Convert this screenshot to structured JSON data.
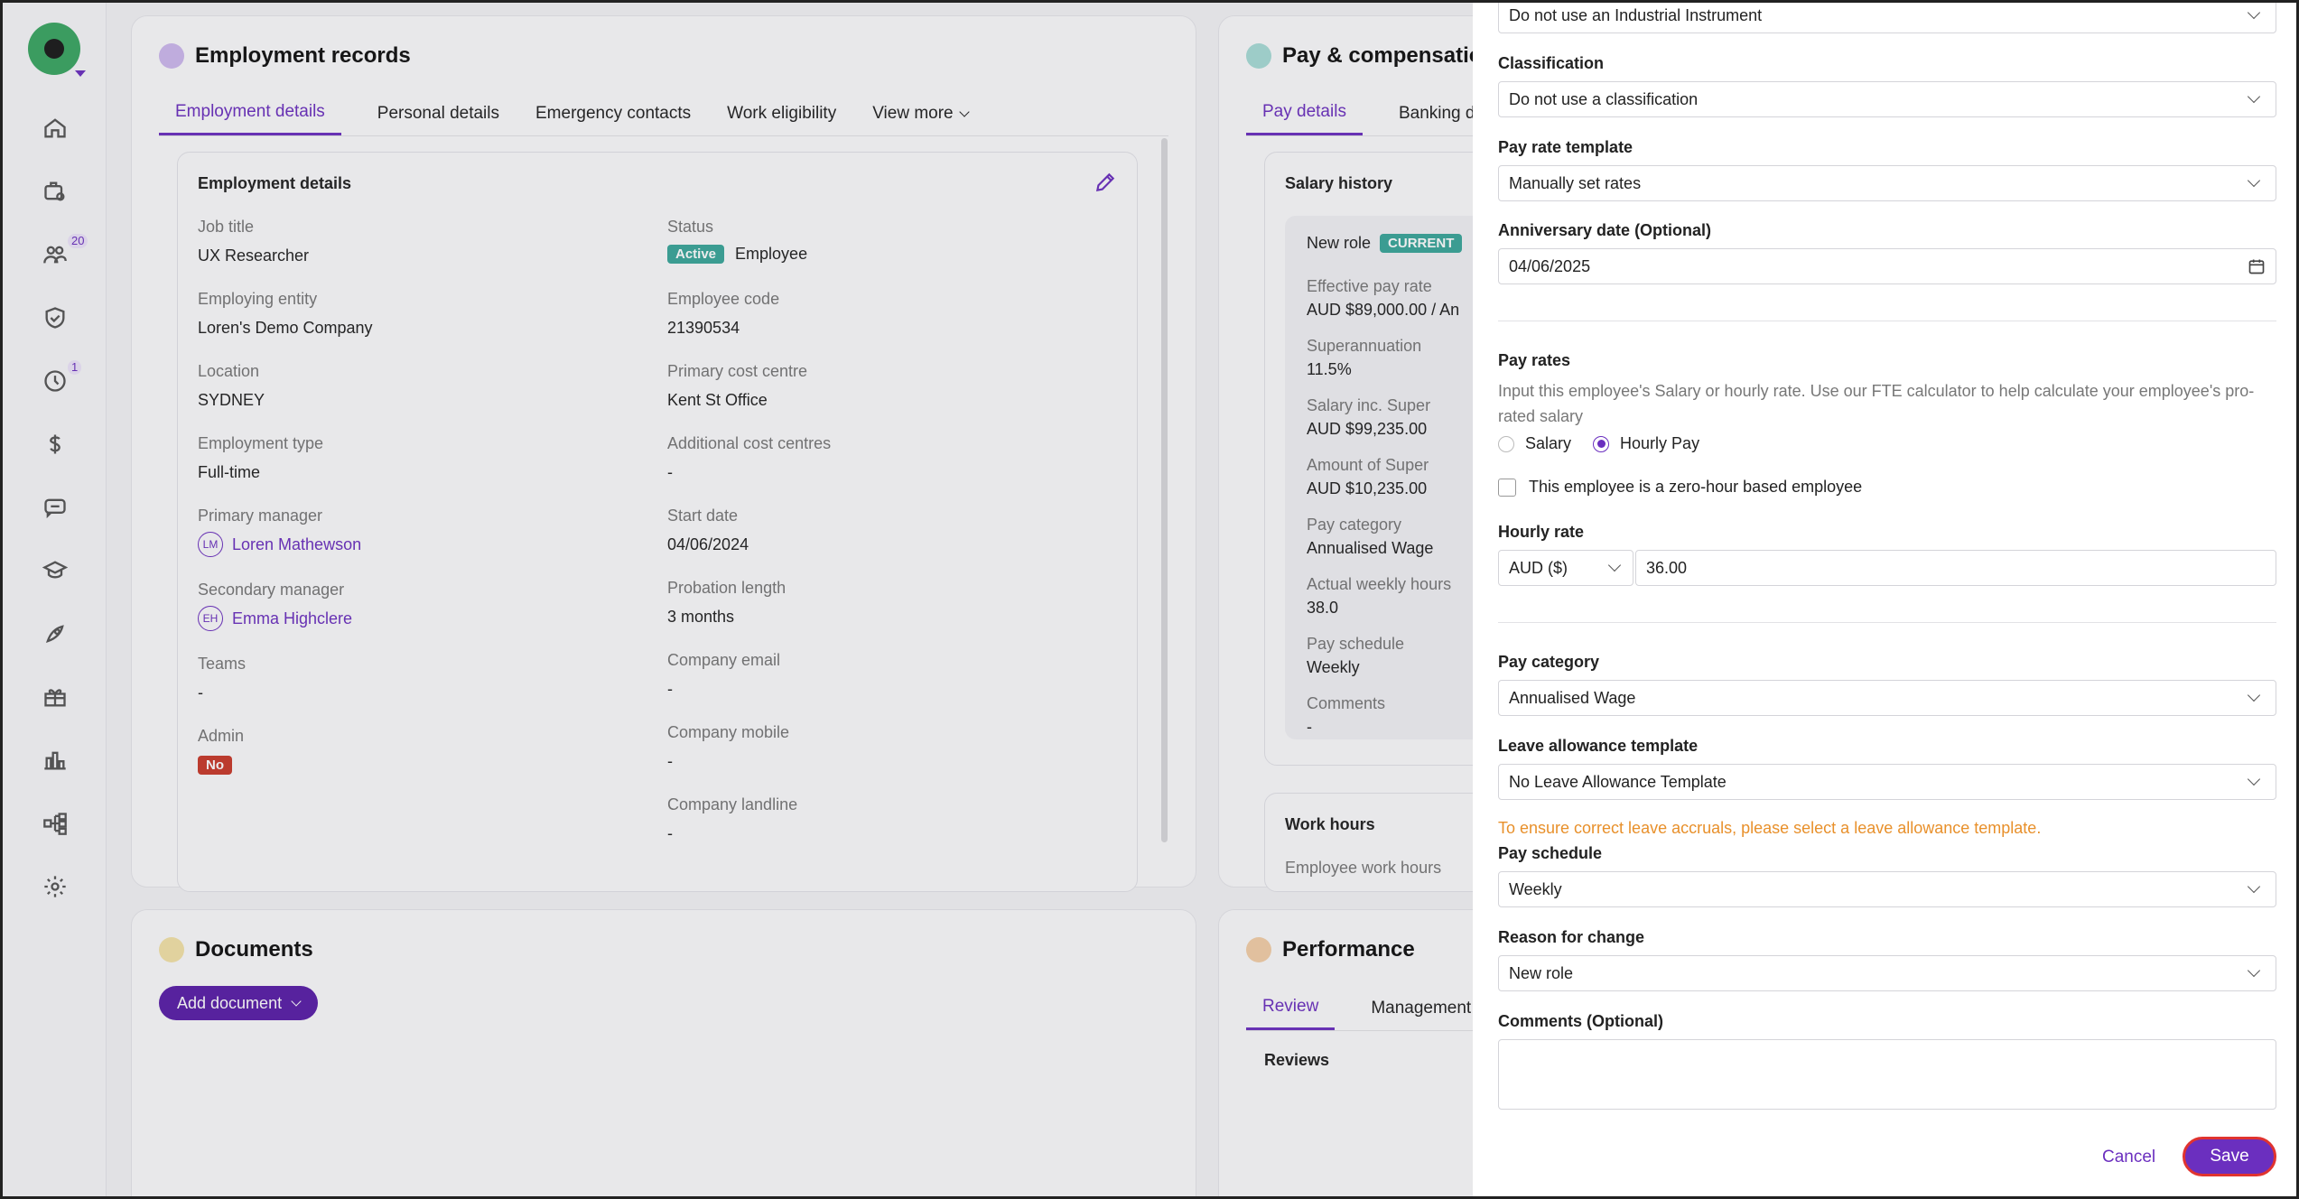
{
  "sidebar": {
    "badges": {
      "people": "20",
      "time": "1"
    }
  },
  "employment": {
    "title": "Employment records",
    "tabs": [
      "Employment details",
      "Personal details",
      "Emergency contacts",
      "Work eligibility",
      "View more"
    ],
    "section_title": "Employment details",
    "left_fields": [
      {
        "label": "Job title",
        "value": "UX Researcher"
      },
      {
        "label": "Employing entity",
        "value": "Loren's Demo Company"
      },
      {
        "label": "Location",
        "value": "SYDNEY"
      },
      {
        "label": "Employment type",
        "value": "Full-time"
      },
      {
        "label": "Primary manager",
        "value": "Loren Mathewson",
        "initials": "LM"
      },
      {
        "label": "Secondary manager",
        "value": "Emma Highclere",
        "initials": "EH"
      },
      {
        "label": "Teams",
        "value": "-"
      },
      {
        "label": "Admin",
        "value": "No"
      }
    ],
    "right_fields": [
      {
        "label": "Status",
        "badge": "Active",
        "value": "Employee"
      },
      {
        "label": "Employee code",
        "value": "21390534"
      },
      {
        "label": "Primary cost centre",
        "value": "Kent St Office"
      },
      {
        "label": "Additional cost centres",
        "value": "-"
      },
      {
        "label": "Start date",
        "value": "04/06/2024"
      },
      {
        "label": "Probation length",
        "value": "3 months"
      },
      {
        "label": "Company email",
        "value": "-"
      },
      {
        "label": "Company mobile",
        "value": "-"
      },
      {
        "label": "Company landline",
        "value": "-"
      }
    ]
  },
  "pay": {
    "title": "Pay & compensatio",
    "tabs": [
      "Pay details",
      "Banking det"
    ],
    "salary_history_title": "Salary history",
    "role_label": "New role",
    "current_badge": "CURRENT",
    "fields": [
      {
        "label": "Effective pay rate",
        "value": "AUD $89,000.00 / An"
      },
      {
        "label": "Superannuation",
        "value": "11.5%"
      },
      {
        "label": "Salary inc. Super",
        "value": "AUD $99,235.00"
      },
      {
        "label": "Amount of Super",
        "value": "AUD $10,235.00"
      },
      {
        "label": "Pay category",
        "value": "Annualised Wage"
      },
      {
        "label": "Actual weekly hours",
        "value": "38.0"
      },
      {
        "label": "Pay schedule",
        "value": "Weekly"
      },
      {
        "label": "Comments",
        "value": "-"
      }
    ],
    "work_hours_title": "Work hours",
    "work_hours_sub": "Employee work hours"
  },
  "documents": {
    "title": "Documents",
    "add_button": "Add document"
  },
  "performance": {
    "title": "Performance",
    "tabs": [
      "Review",
      "Management n"
    ],
    "reviews_label": "Reviews"
  },
  "drawer": {
    "industrial_instrument": "Do not use an Industrial Instrument",
    "classification_label": "Classification",
    "classification_value": "Do not use a classification",
    "pay_rate_template_label": "Pay rate template",
    "pay_rate_template_value": "Manually set rates",
    "anniversary_label": "Anniversary date (Optional)",
    "anniversary_value": "04/06/2025",
    "pay_rates_label": "Pay rates",
    "pay_rates_help": "Input this employee's Salary or hourly rate. Use our FTE calculator to help calculate your employee's pro-rated salary",
    "radio_salary": "Salary",
    "radio_hourly": "Hourly Pay",
    "zero_hour_label": "This employee is a zero-hour based employee",
    "hourly_rate_label": "Hourly rate",
    "currency_value": "AUD ($)",
    "hourly_rate_value": "36.00",
    "pay_category_label": "Pay category",
    "pay_category_value": "Annualised Wage",
    "leave_template_label": "Leave allowance template",
    "leave_template_value": "No Leave Allowance Template",
    "leave_warning": "To ensure correct leave accruals, please select a leave allowance template.",
    "pay_schedule_label": "Pay schedule",
    "pay_schedule_value": "Weekly",
    "reason_label": "Reason for change",
    "reason_value": "New role",
    "comments_label": "Comments (Optional)",
    "cancel": "Cancel",
    "save": "Save"
  },
  "colors": {
    "accent": "#6b2fbf",
    "warning": "#e8902b",
    "active": "#3aa69a",
    "danger": "#c93a2b"
  }
}
